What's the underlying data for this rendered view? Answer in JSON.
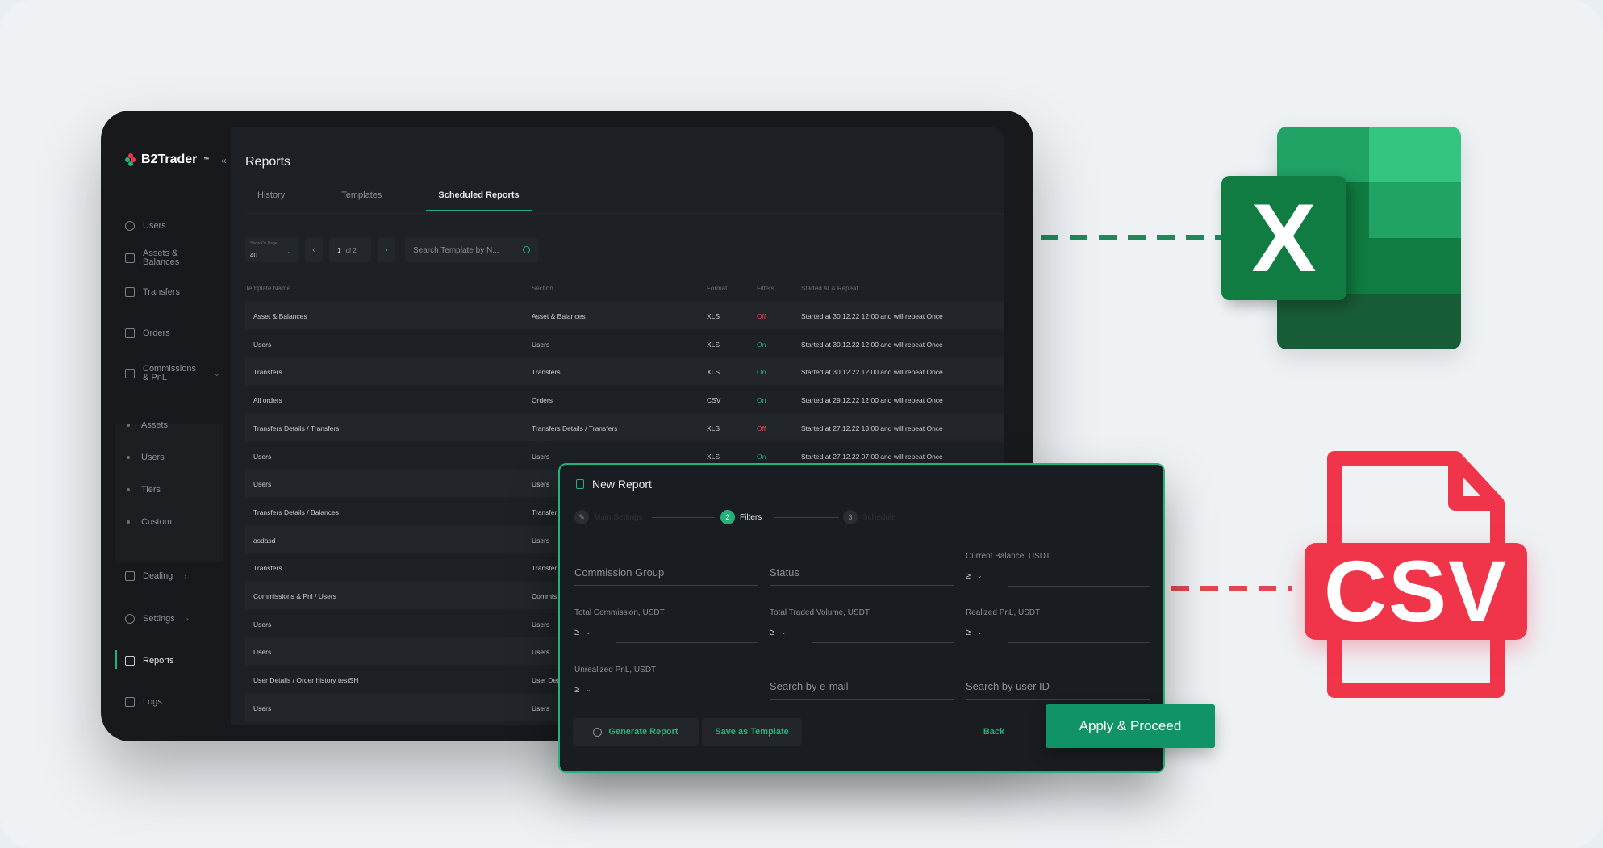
{
  "app": {
    "brand": "B2Trader",
    "brand_tm": "™",
    "collapse_glyph": "«"
  },
  "colors": {
    "accent": "#23b37a",
    "off": "#e2474f",
    "excel": "#107c41",
    "csv": "#f0344a"
  },
  "sidebar": {
    "items": [
      {
        "label": "Users",
        "icon": "user-icon"
      },
      {
        "label": "Assets & Balances",
        "icon": "database-icon"
      },
      {
        "label": "Transfers",
        "icon": "transfer-icon"
      },
      {
        "label": "Orders",
        "icon": "orders-icon"
      },
      {
        "label": "Commissions & PnL",
        "icon": "tag-icon"
      },
      {
        "label": "Dealing",
        "icon": "dealing-icon"
      },
      {
        "label": "Settings",
        "icon": "gear-icon"
      },
      {
        "label": "Reports",
        "icon": "report-icon"
      },
      {
        "label": "Logs",
        "icon": "logs-icon"
      }
    ],
    "subitems": [
      "Assets",
      "Users",
      "Tiers",
      "Custom"
    ],
    "chevron": "›",
    "chevron_down": "⌄"
  },
  "page": {
    "title": "Reports",
    "tabs": [
      "History",
      "Templates",
      "Scheduled Reports"
    ],
    "active_tab": 2
  },
  "controls": {
    "per_page_label": "Show On Page",
    "per_page_value": "40",
    "page_current": "1",
    "page_total": "of 2",
    "search_placeholder": "Search Template by N...",
    "prev_glyph": "‹",
    "next_glyph": "›",
    "caret_glyph": "⌄"
  },
  "table": {
    "columns": [
      "Template Name",
      "Section",
      "Format",
      "Filters",
      "Started At & Repeat"
    ],
    "rows": [
      {
        "name": "Asset & Balances",
        "section": "Asset & Balances",
        "format": "XLS",
        "filters": "Off",
        "started": "Started at 30.12.22 12:00 and will repeat Once"
      },
      {
        "name": "Users",
        "section": "Users",
        "format": "XLS",
        "filters": "On",
        "started": "Started at 30.12.22 12:00 and will repeat Once"
      },
      {
        "name": "Transfers",
        "section": "Transfers",
        "format": "XLS",
        "filters": "On",
        "started": "Started at 30.12.22 12:00 and will repeat Once"
      },
      {
        "name": "All orders",
        "section": "Orders",
        "format": "CSV",
        "filters": "On",
        "started": "Started at 29.12.22 12:00 and will repeat Once"
      },
      {
        "name": "Transfers Details / Transfers",
        "section": "Transfers Details / Transfers",
        "format": "XLS",
        "filters": "Off",
        "started": "Started at 27.12.22 13:00 and will repeat Once"
      },
      {
        "name": "Users",
        "section": "Users",
        "format": "XLS",
        "filters": "On",
        "started": "Started at 27.12.22 07:00 and will repeat Once"
      },
      {
        "name": "Users",
        "section": "Users",
        "format": "",
        "filters": "",
        "started": ""
      },
      {
        "name": "Transfers Details / Balances",
        "section": "Transfer",
        "format": "",
        "filters": "",
        "started": ""
      },
      {
        "name": "asdasd",
        "section": "Users",
        "format": "",
        "filters": "",
        "started": ""
      },
      {
        "name": "Transfers",
        "section": "Transfer",
        "format": "",
        "filters": "",
        "started": ""
      },
      {
        "name": "Commissions & Pnl / Users",
        "section": "Commis",
        "format": "",
        "filters": "",
        "started": ""
      },
      {
        "name": "Users",
        "section": "Users",
        "format": "",
        "filters": "",
        "started": ""
      },
      {
        "name": "Users",
        "section": "Users",
        "format": "",
        "filters": "",
        "started": ""
      },
      {
        "name": "User Details / Order history testSH",
        "section": "User Det",
        "format": "",
        "filters": "",
        "started": ""
      },
      {
        "name": "Users",
        "section": "Users",
        "format": "",
        "filters": "",
        "started": ""
      }
    ]
  },
  "modal": {
    "title": "New Report",
    "steps": [
      {
        "num": "",
        "label": "Main Settings"
      },
      {
        "num": "2",
        "label": "Filters"
      },
      {
        "num": "3",
        "label": "Schedule"
      }
    ],
    "fields": {
      "commission_group": "Commission Group",
      "status": "Status",
      "current_balance": "Current Balance, USDT",
      "total_commission": "Total Commission, USDT",
      "total_traded_volume": "Total Traded Volume, USDT",
      "realized_pnl": "Realized PnL, USDT",
      "unrealized_pnl": "Unrealized PnL, USDT",
      "search_email": "Search by e-mail",
      "search_user_id": "Search by user ID",
      "operator": "≥",
      "op_caret": "⌄"
    },
    "buttons": {
      "generate": "Generate Report",
      "save_template": "Save as Template",
      "back": "Back",
      "apply": "Apply & Proceed"
    }
  },
  "badges": {
    "excel_letter": "X",
    "csv_label": "CSV"
  }
}
